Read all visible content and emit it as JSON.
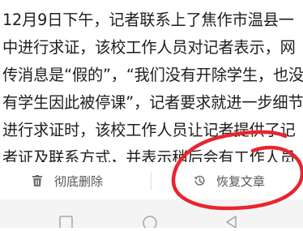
{
  "article": {
    "lines": [
      "12月9日下午，记者联系上了焦作市温县一",
      "中进行求证，该校工作人员对记者表示，网",
      "传消息是“假的”，“我们没有开除学生，也没",
      "有学生因此被停课”，记者要求就进一步细节",
      "进行求证时，该校工作人员让记者提供了记",
      "者证及联系方式，并表示稍后会有工作人员"
    ]
  },
  "actions": {
    "delete_label": "彻底删除",
    "restore_label": "恢复文章",
    "delete_icon": "trash-icon",
    "restore_icon": "history-icon"
  },
  "navigation": {
    "buttons": [
      "recent-apps-button",
      "home-button",
      "back-button"
    ]
  },
  "colors": {
    "text": "#1d1d1d",
    "action_text": "#555555",
    "annotation": "#e8252f",
    "nav_background": "#f4f4f4"
  }
}
